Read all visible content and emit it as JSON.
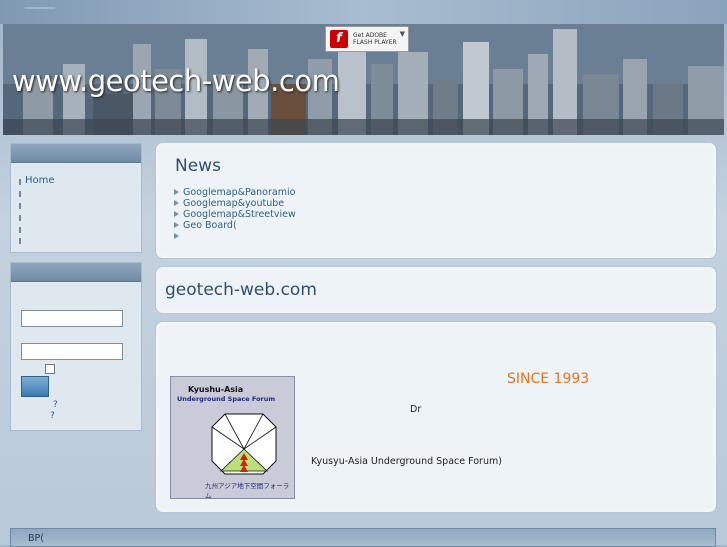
{
  "header": {
    "site_title": "www.geotech-web.com",
    "flash_badge": {
      "line1": "Get ADOBE",
      "line2": "FLASH PLAYER",
      "logo": "f",
      "download_icon": "download-arrow-icon"
    }
  },
  "sidebar": {
    "menu": {
      "items": [
        {
          "label": "Home"
        }
      ]
    },
    "login": {
      "qmark1": "?",
      "qmark2": "?"
    }
  },
  "news": {
    "title": "News",
    "items": [
      {
        "label": "Googlemap&Panoramio"
      },
      {
        "label": "Googlemap&youtube"
      },
      {
        "label": "Googlemap&Streetview"
      },
      {
        "label": "Geo Board("
      },
      {
        "label": ""
      }
    ]
  },
  "site_panel": {
    "name": "geotech-web.com"
  },
  "content": {
    "logo": {
      "title": "Kyushu-Asia",
      "subtitle": "Underground Space Forum",
      "caption": "九州アジア地下空間フォーラム"
    },
    "since": "SINCE 1993",
    "dr": "Dr",
    "forum": "Kyusyu-Asia Underground Space Forum)"
  },
  "footer": {
    "text": "BP("
  },
  "colors": {
    "accent": "#e8731a",
    "link": "#2f5f8a",
    "heading": "#2f4f6f"
  }
}
